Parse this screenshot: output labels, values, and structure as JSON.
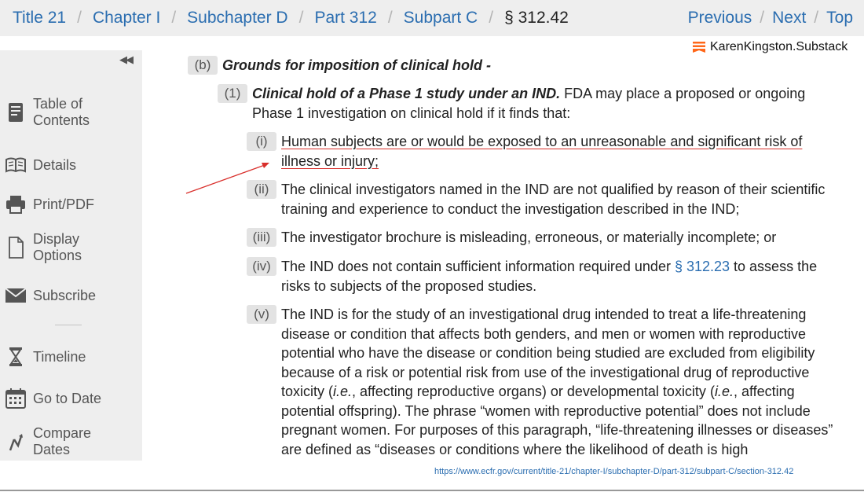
{
  "breadcrumb": {
    "items": [
      "Title 21",
      "Chapter I",
      "Subchapter D",
      "Part 312",
      "Subpart C"
    ],
    "current": "§ 312.42",
    "separator": "/"
  },
  "topnav": {
    "previous": "Previous",
    "next": "Next",
    "top": "Top",
    "separator": "/"
  },
  "sidebar": {
    "items": [
      {
        "label": "Table of Contents",
        "icon": "book-icon"
      },
      {
        "label": "Details",
        "icon": "open-book-icon"
      },
      {
        "label": "Print/PDF",
        "icon": "printer-icon"
      },
      {
        "label": "Display Options",
        "icon": "document-icon"
      },
      {
        "label": "Subscribe",
        "icon": "envelope-icon"
      },
      {
        "label": "Timeline",
        "icon": "hourglass-icon"
      },
      {
        "label": "Go to Date",
        "icon": "calendar-icon"
      },
      {
        "label": "Compare Dates",
        "icon": "compare-icon"
      }
    ]
  },
  "content": {
    "b": {
      "num": "(b)",
      "title": "Grounds for imposition of clinical hold",
      "suffix": " -"
    },
    "p1": {
      "num": "(1)",
      "title": "Clinical hold of a Phase 1 study under an IND.",
      "text": " FDA may place a proposed or ongoing Phase 1 investigation on clinical hold if it finds that:"
    },
    "i": {
      "num": "(i)",
      "text": "Human subjects are or would be exposed to an unreasonable and significant risk of illness or injury;"
    },
    "ii": {
      "num": "(ii)",
      "text": "The clinical investigators named in the IND are not qualified by reason of their scientific training and experience to conduct the investigation described in the IND;"
    },
    "iii": {
      "num": "(iii)",
      "text": "The investigator brochure is misleading, erroneous, or materially incomplete; or"
    },
    "iv": {
      "num": "(iv)",
      "text_a": "The IND does not contain sufficient information required under ",
      "link": "§ 312.23",
      "text_b": " to assess the risks to subjects of the proposed studies."
    },
    "v": {
      "num": "(v)",
      "text_a": "The IND is for the study of an investigational drug intended to treat a life-threatening disease or condition that affects both genders, and men or women with reproductive potential who have the disease or condition being studied are excluded from eligibility because of a risk or potential risk from use of the investigational drug of reproductive toxicity (",
      "ie1": "i.e.",
      "text_b": ", affecting reproductive organs) or developmental toxicity (",
      "ie2": "i.e.",
      "text_c": ", affecting potential offspring). The phrase “women with reproductive potential” does not include pregnant women. For purposes of this paragraph, “life-threatening illnesses or diseases” are defined as “diseases or conditions where the likelihood of death is high"
    }
  },
  "watermark": {
    "text": "KarenKingston.Substack"
  },
  "source_url": "https://www.ecfr.gov/current/title-21/chapter-I/subchapter-D/part-312/subpart-C/section-312.42",
  "colors": {
    "link": "#2a6db0",
    "annotation": "#d9302c",
    "sidebar_bg": "#eeeeee",
    "substack": "#ff6719"
  }
}
